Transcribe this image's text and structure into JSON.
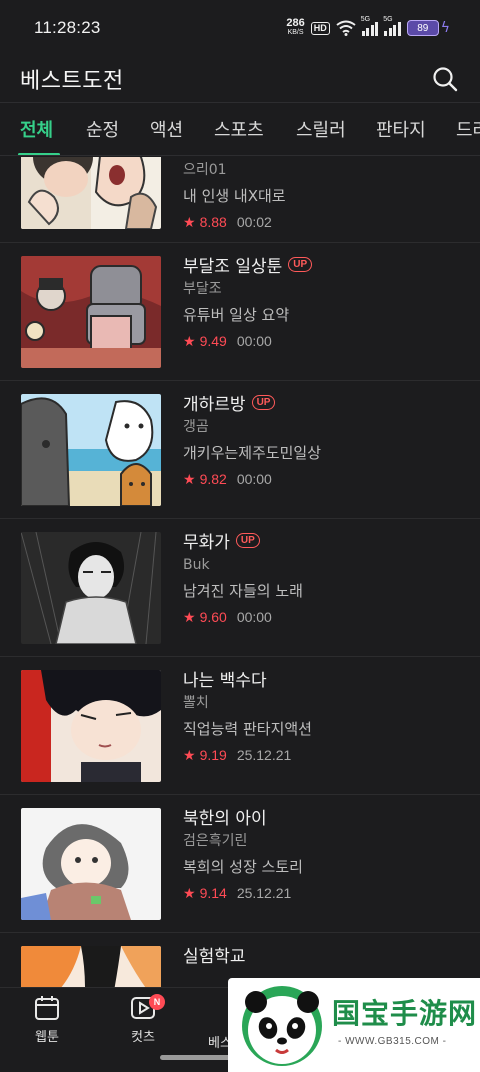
{
  "status_bar": {
    "time": "11:28:23",
    "net_speed": "286",
    "net_unit": "KB/S",
    "hd": "HD",
    "sig1_tag": "5G",
    "sig2_tag": "5G",
    "battery": "89"
  },
  "header": {
    "title": "베스트도전",
    "search_icon": "search-icon"
  },
  "tabs": [
    {
      "label": "전체",
      "active": true
    },
    {
      "label": "순정"
    },
    {
      "label": "액션"
    },
    {
      "label": "스포츠"
    },
    {
      "label": "스릴러"
    },
    {
      "label": "판타지"
    },
    {
      "label": "드라"
    }
  ],
  "items": [
    {
      "title": "",
      "author": "으리01",
      "desc": "내 인생 내X대로",
      "rating": "8.88",
      "time": "00:02",
      "up": false
    },
    {
      "title": "부달조 일상툰",
      "author": "부달조",
      "desc": "유튜버 일상 요약",
      "rating": "9.49",
      "time": "00:00",
      "up": true
    },
    {
      "title": "개하르방",
      "author": "갱곰",
      "desc": "개키우는제주도민일상",
      "rating": "9.82",
      "time": "00:00",
      "up": true
    },
    {
      "title": "무화가",
      "author": "Buk",
      "desc": "남겨진 자들의 노래",
      "rating": "9.60",
      "time": "00:00",
      "up": true
    },
    {
      "title": "나는 백수다",
      "author": "뽈치",
      "desc": "직업능력 판타지액션",
      "rating": "9.19",
      "time": "25.12.21",
      "up": false
    },
    {
      "title": "북한의 아이",
      "author": "검은흑기린",
      "desc": "복희의 성장 스토리",
      "rating": "9.14",
      "time": "25.12.21",
      "up": false
    },
    {
      "title": "실험학교",
      "author": "",
      "desc": "",
      "rating": "",
      "time": "",
      "up": false
    }
  ],
  "up_label": "UP",
  "bottom_nav": {
    "webtoon": "웹툰",
    "cuts": "컷츠",
    "cuts_badge": "N",
    "best": "베스"
  },
  "watermark": {
    "name": "国宝手游网",
    "url": "- WWW.GB315.COM -"
  },
  "colors": {
    "accent": "#36d08a",
    "rating": "#ff4b55",
    "background": "#1c1c1e"
  }
}
